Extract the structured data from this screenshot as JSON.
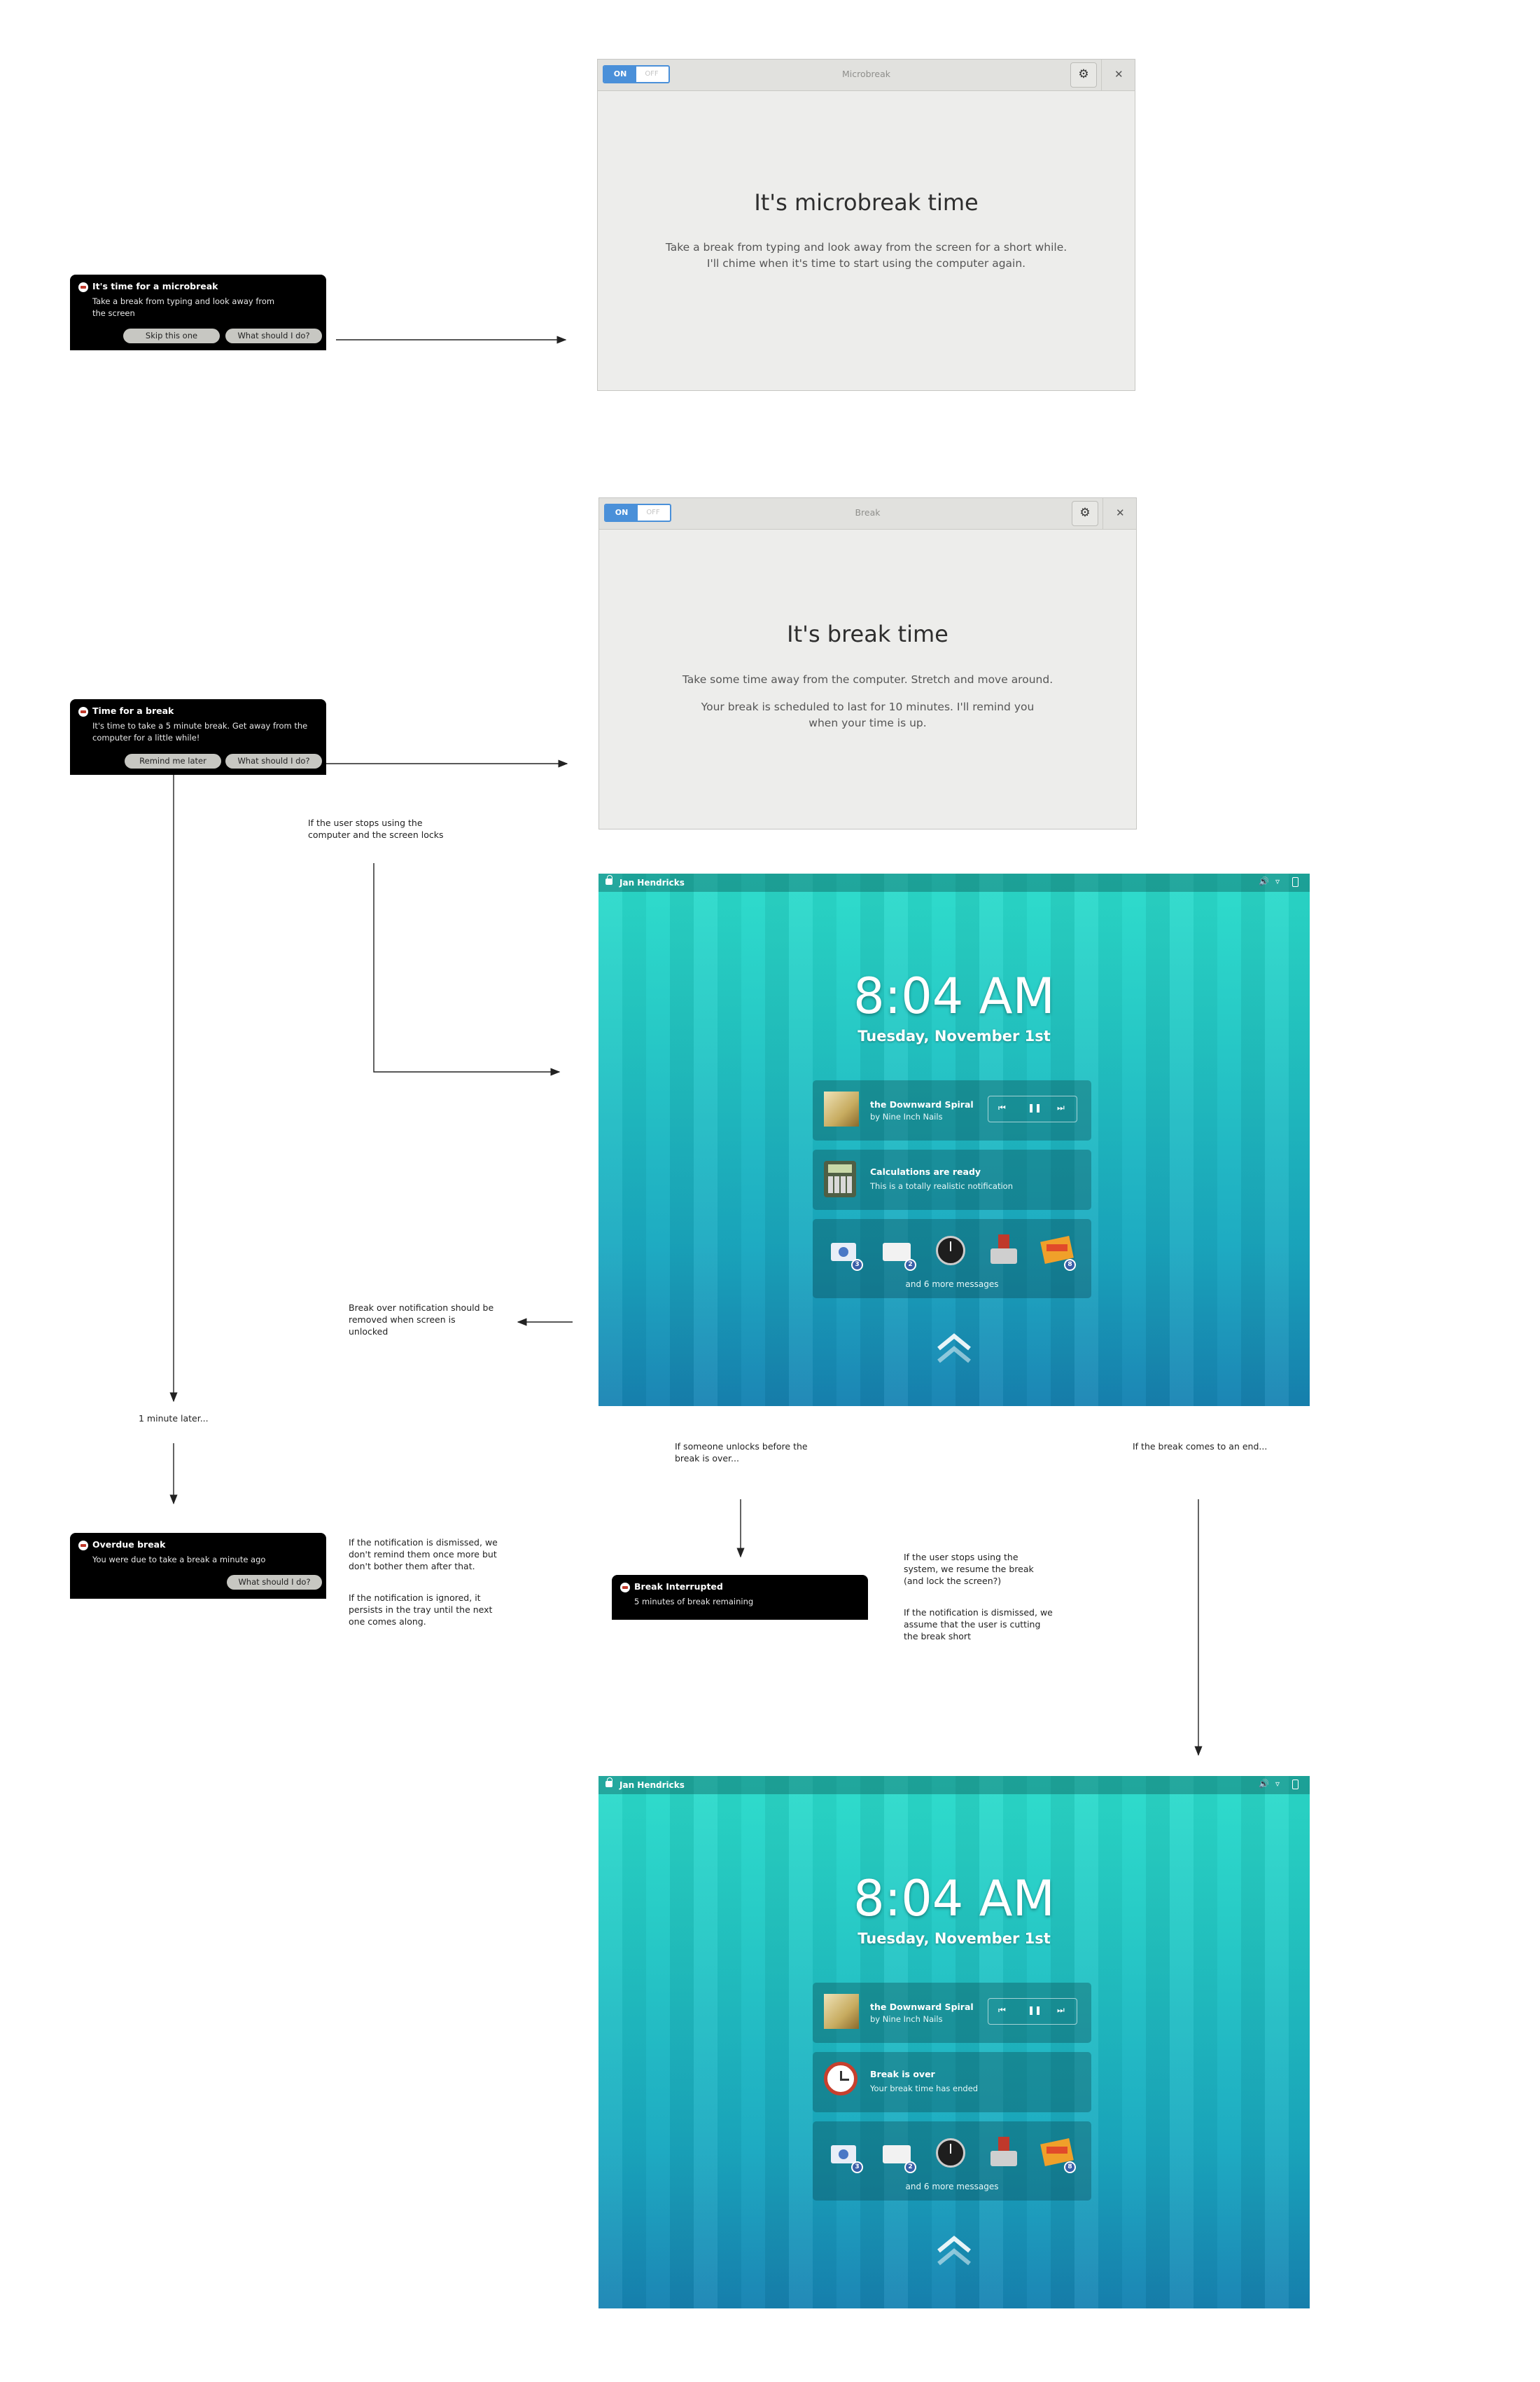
{
  "notifications": {
    "microbreak": {
      "title": "It's time for a microbreak",
      "body_line1": "Take a break from typing and look away from",
      "body_line2": "the screen",
      "button_skip": "Skip this one",
      "button_help": "What should I do?"
    },
    "break": {
      "title": "Time for a break",
      "body_line1": "It's time to take a 5 minute break. Get away from the",
      "body_line2": "computer for a little while!",
      "button_remind": "Remind me later",
      "button_help": "What should I do?"
    },
    "overdue": {
      "title": "Overdue break",
      "body": "You were due to take a break a minute ago",
      "button_help": "What should I do?"
    },
    "interrupted": {
      "title": "Break Interrupted",
      "body": "5 minutes of break remaining"
    }
  },
  "windows": {
    "microbreak": {
      "switch_on": "ON",
      "switch_off": "OFF",
      "title": "Microbreak",
      "heading": "It's microbreak time",
      "line1": "Take a break from typing and look away from the screen for a short while.",
      "line2": "I'll chime when it's time to start using the computer again."
    },
    "break": {
      "switch_on": "ON",
      "switch_off": "OFF",
      "title": "Break",
      "heading": "It's break time",
      "line1": "Take some time away from the computer. Stretch and move around.",
      "line2": "Your break is scheduled to last for 10 minutes. I'll remind you",
      "line3": "when your time is up."
    }
  },
  "lockscreens": {
    "first": {
      "user": "Jan Hendricks",
      "time": "8:04 AM",
      "date": "Tuesday, November 1st",
      "media_title": "the Downward Spiral",
      "media_artist": "by Nine Inch Nails",
      "notif_title": "Calculations are ready",
      "notif_body": "This is a totally realistic notification",
      "more_messages": "and 6 more messages"
    },
    "second": {
      "user": "Jan Hendricks",
      "time": "8:04 AM",
      "date": "Tuesday, November 1st",
      "media_title": "the Downward Spiral",
      "media_artist": "by Nine Inch Nails",
      "notif_title": "Break is over",
      "notif_body": "Your break time has ended",
      "more_messages": "and 6 more messages"
    }
  },
  "annotations": {
    "screen_locks": [
      "If the user stops using the",
      "computer and the screen locks"
    ],
    "break_over_removed": [
      "Break over notification should be",
      "removed when screen is",
      "unlocked"
    ],
    "minute_later": "1 minute later...",
    "dismissed": [
      "If the notification is dismissed, we",
      "don't remind them once more but",
      "don't bother them after that."
    ],
    "ignored": [
      "If the notification is ignored, it",
      "persists in the tray until the next",
      "one comes along."
    ],
    "someone_unlocks": [
      "If someone unlocks before the",
      "break is over..."
    ],
    "break_ends": "If the break comes to an end...",
    "stops_using": [
      "If the user stops using the",
      "system, we resume the break",
      "(and lock the screen?)"
    ],
    "cut_short": [
      "If the notification is dismissed, we",
      "assume that the user is cutting",
      "the break short"
    ]
  },
  "colors": {
    "accent": "#4a90d9",
    "notification_bg": "#000000",
    "lockscreen_top": "#2bdccb",
    "lockscreen_bottom": "#1783b3"
  }
}
